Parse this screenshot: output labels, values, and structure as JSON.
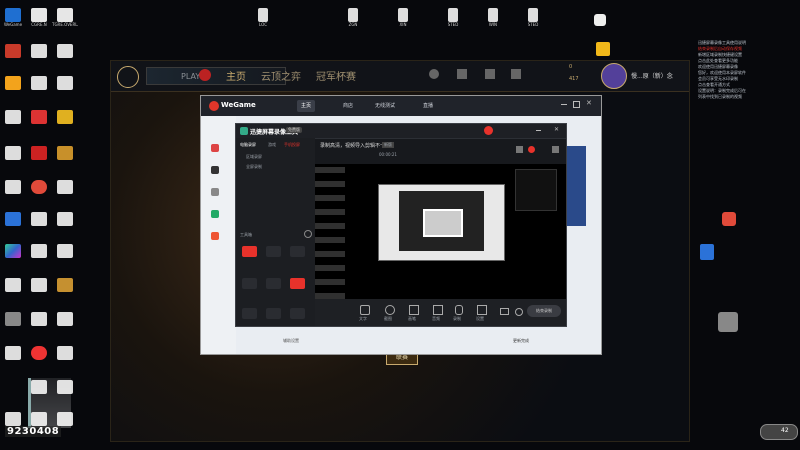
{
  "desktop": {
    "icons": [
      {
        "label": "WeGame"
      },
      {
        "label": "CGRE.N"
      },
      {
        "label": "TGRE.OVERLAY"
      },
      {
        "label": ""
      },
      {
        "label": ""
      },
      {
        "label": ""
      },
      {
        "label": ""
      },
      {
        "label": ""
      },
      {
        "label": ""
      },
      {
        "label": ""
      }
    ],
    "top_labels": [
      "LOC",
      "ZGN",
      "XIN",
      "STED",
      "WIN",
      "STED"
    ]
  },
  "launcher": {
    "play_label": "PLAY",
    "nav": [
      "主页",
      "云顶之弈",
      "冠军杯赛"
    ],
    "profile_name": "慢...原（新）念",
    "bottom_button": "联赛",
    "currency_a": "0",
    "currency_b": "417"
  },
  "wegame": {
    "logo": "WeGame",
    "tabs": [
      "主页",
      "商店",
      "无线测试",
      "直播"
    ],
    "bottom_left": "辅助设置",
    "bottom_right": "更新完成"
  },
  "recorder": {
    "title": "迅捷屏幕录像工具",
    "badge": "免费版",
    "left_tabs": [
      "电脑录屏",
      "游戏",
      "手机投屏"
    ],
    "left_items": [
      "区域录屏",
      "全屏录制"
    ],
    "section_label": "工具箱",
    "tools": [
      "录屏助手",
      "视频剪辑",
      "文件转换",
      "视频压缩",
      "录制设置",
      "定时录制",
      "视频转换",
      "画面绘制",
      "录音",
      "音频转换",
      "画中画",
      "截图"
    ],
    "top_text": "录制高清，视频导入剪辑不卡",
    "top_badge": "新版",
    "bottom_controls": [
      "文字",
      "截图",
      "画笔",
      "音频",
      "录制",
      "设置"
    ],
    "rec_button": "结束录制",
    "timer": "00:00:21"
  },
  "sidepanel": {
    "lines": [
      "迅捷屏幕录像工具使用说明",
      "结束录制后自动保存视频",
      "新增区域录制快捷键设置",
      "点击此处查看更多功能",
      "",
      "欢迎使用迅捷屏幕录像",
      "您好，欢迎使用本录屏软件",
      "会员可享受无水印录制",
      "点击查看开通方式",
      "",
      "设置说明：录制完成后可在",
      "列表中找到已录制的视频"
    ]
  },
  "watermark": {
    "text": "9230408"
  },
  "taskbar": {
    "clock_badge": "42"
  },
  "colors": {
    "accent_gold": "#c8aa6e",
    "wegame_red": "#e0362a",
    "record_red": "#e8322b",
    "desktop_bg": "#07080c"
  }
}
